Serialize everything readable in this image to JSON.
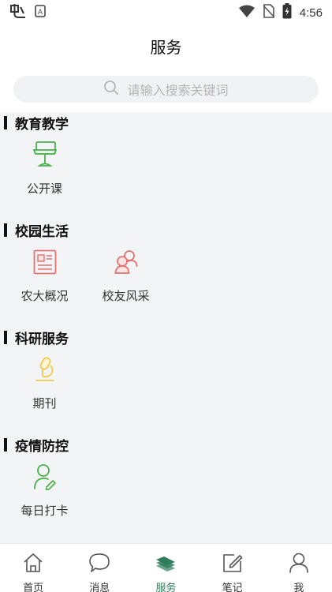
{
  "status_bar": {
    "time": "4:56",
    "left_icons": [
      "app-icon",
      "a-notification-icon"
    ],
    "right_icons": [
      "wifi-icon",
      "no-sim-icon",
      "battery-charging-icon"
    ]
  },
  "header": {
    "title": "服务"
  },
  "search": {
    "placeholder": "请输入搜索关键词"
  },
  "sections": [
    {
      "title": "教育教学",
      "items": [
        {
          "label": "公开课",
          "icon": "lectern-icon",
          "color": "#4caf50"
        }
      ]
    },
    {
      "title": "校园生活",
      "items": [
        {
          "label": "农大概况",
          "icon": "newspaper-icon",
          "color": "#e57373"
        },
        {
          "label": "校友风采",
          "icon": "users-icon",
          "color": "#e57373"
        }
      ]
    },
    {
      "title": "科研服务",
      "items": [
        {
          "label": "期刊",
          "icon": "microscope-icon",
          "color": "#f2c94c"
        }
      ]
    },
    {
      "title": "疫情防控",
      "items": [
        {
          "label": "每日打卡",
          "icon": "user-edit-icon",
          "color": "#4caf50"
        }
      ]
    }
  ],
  "bottom_nav": {
    "items": [
      {
        "label": "首页",
        "icon": "home-icon"
      },
      {
        "label": "消息",
        "icon": "chat-bubble-icon"
      },
      {
        "label": "服务",
        "icon": "layers-icon",
        "active": true
      },
      {
        "label": "笔记",
        "icon": "note-edit-icon"
      },
      {
        "label": "我",
        "icon": "user-icon"
      }
    ],
    "active_color": "#2e7d5b"
  }
}
